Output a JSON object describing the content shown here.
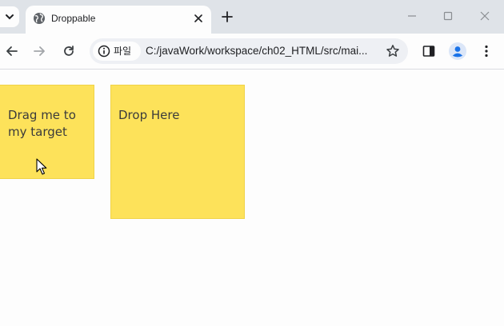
{
  "browser": {
    "tab": {
      "title": "Droppable"
    },
    "omnibox": {
      "chip_label": "파일",
      "url": "C:/javaWork/workspace/ch02_HTML/src/mai..."
    }
  },
  "page": {
    "draggable_text": "Drag me to my target",
    "droppable_text": "Drop Here"
  },
  "colors": {
    "box_fill": "#fde25a",
    "tabstrip": "#dfe3e8",
    "avatar": "#1a73e8"
  },
  "icons": [
    "tab-search-icon",
    "globe-icon",
    "close-icon",
    "plus-icon",
    "minimize-icon",
    "maximize-icon",
    "window-close-icon",
    "back-icon",
    "forward-icon",
    "reload-icon",
    "info-icon",
    "star-icon",
    "side-panel-icon",
    "profile-icon",
    "menu-icon",
    "cursor-icon"
  ]
}
